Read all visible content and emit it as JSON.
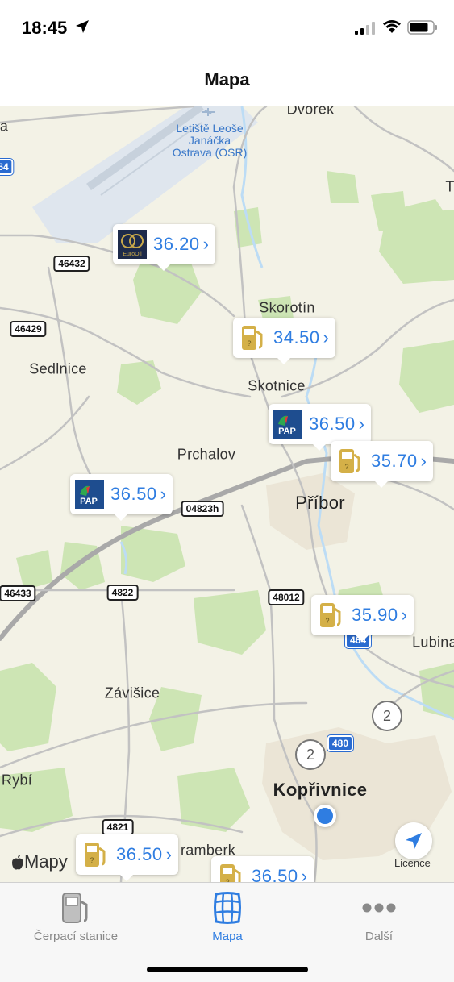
{
  "status_bar": {
    "time": "18:45"
  },
  "nav": {
    "title": "Mapa"
  },
  "map": {
    "places": {
      "dvorek": "Dvorek",
      "skorotin": "Skorotín",
      "sedlnice": "Sedlnice",
      "skotnice": "Skotnice",
      "prchalov": "Prchalov",
      "pribor": "Příbor",
      "lubina": "Lubina",
      "zavisice": "Závišice",
      "koprivnice": "Kopřivnice",
      "rybi": "Rybí",
      "stramberk": "ramberk",
      "edge_a": "a",
      "edge_t": "T"
    },
    "airport": {
      "line1": "Letiště Leoše",
      "line2": "Janáčka",
      "line3": "Ostrava (OSR)"
    },
    "roads": {
      "r46432": "46432",
      "r46429": "46429",
      "r04823h": "04823h",
      "r46433": "46433",
      "r4822": "4822",
      "r48012": "48012",
      "r4821": "4821",
      "r464": "464",
      "r480": "480",
      "r64": "64"
    },
    "stations": [
      {
        "price": "36.20",
        "logo": "eurooil-logo"
      },
      {
        "price": "34.50",
        "logo": "pump-icon"
      },
      {
        "price": "36.50",
        "logo": "pap-oil-logo"
      },
      {
        "price": "35.70",
        "logo": "pump-icon"
      },
      {
        "price": "36.50",
        "logo": "pap-oil-logo"
      },
      {
        "price": "35.90",
        "logo": "pump-icon"
      },
      {
        "price": "36.50",
        "logo": "pump-icon"
      },
      {
        "price": "36.50",
        "logo": "pump-icon"
      }
    ],
    "clusters": [
      "2",
      "2"
    ],
    "attribution": "Mapy",
    "licence": "Licence",
    "colors": {
      "land": "#f3f2e6",
      "forest": "#cde5b4",
      "water": "#bcdcf5",
      "urban": "#ebe5d6",
      "road": "#b8b8b8",
      "price": "#2f7de1"
    }
  },
  "tabs": [
    {
      "label": "Čerpací stanice",
      "icon": "fuel-station-icon"
    },
    {
      "label": "Mapa",
      "icon": "map-grid-icon"
    },
    {
      "label": "Další",
      "icon": "more-dots-icon"
    }
  ]
}
